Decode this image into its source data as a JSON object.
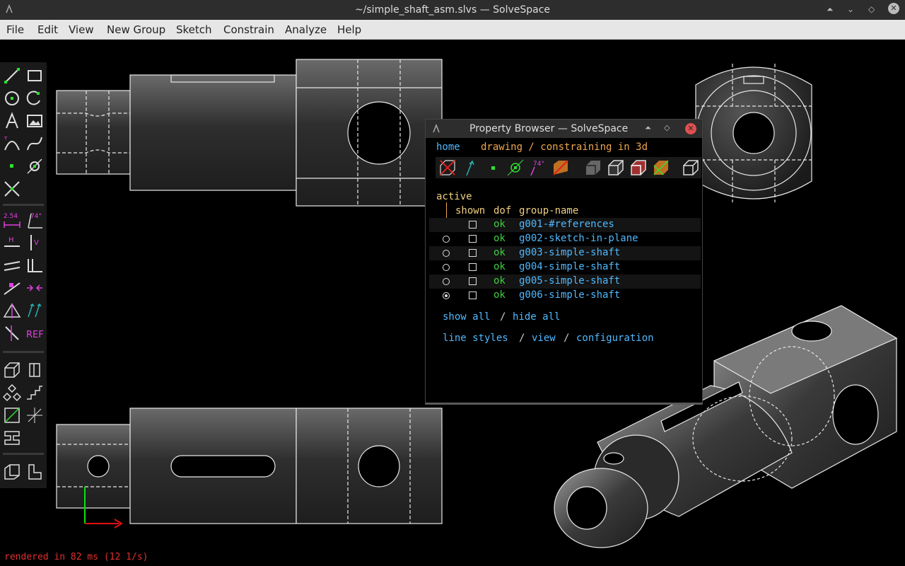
{
  "window": {
    "title": "~/simple_shaft_asm.slvs — SolveSpace"
  },
  "menu": [
    "File",
    "Edit",
    "View",
    "New Group",
    "Sketch",
    "Constrain",
    "Analyze",
    "Help"
  ],
  "toolbar_labels": {
    "dimension": "2.54",
    "angle": "74°",
    "horizontal": "H",
    "vertical": "V",
    "reference": "REF"
  },
  "property_browser": {
    "title": "Property Browser — SolveSpace",
    "home_link": "home",
    "mode_text": "drawing / constraining in 3d",
    "toolbar_angle": "74°",
    "active_label": "active",
    "columns": {
      "shown": "shown",
      "dof": "dof",
      "group_name": "group-name"
    },
    "groups": [
      {
        "name": "g001-#references",
        "dof": "ok",
        "active": false
      },
      {
        "name": "g002-sketch-in-plane",
        "dof": "ok",
        "active": false
      },
      {
        "name": "g003-simple-shaft",
        "dof": "ok",
        "active": false
      },
      {
        "name": "g004-simple-shaft",
        "dof": "ok",
        "active": false
      },
      {
        "name": "g005-simple-shaft",
        "dof": "ok",
        "active": false
      },
      {
        "name": "g006-simple-shaft",
        "dof": "ok",
        "active": true
      }
    ],
    "show_all": "show all",
    "hide_all": "hide all",
    "line_styles": "line styles",
    "view": "view",
    "configuration": "configuration",
    "sep": "/"
  },
  "status": {
    "text": "rendered in 82 ms (12 1/s)"
  },
  "colors": {
    "link": "#4fb9ff",
    "orange": "#f0a64e",
    "green": "#3fd03f",
    "status_red": "#e03030",
    "tool_green": "#2ee02e",
    "tool_magenta": "#e040e0"
  }
}
